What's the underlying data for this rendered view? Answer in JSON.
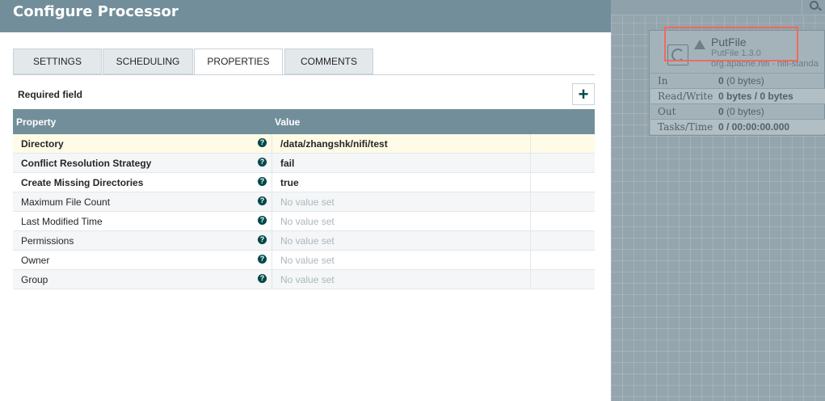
{
  "dialog": {
    "title": "Configure Processor",
    "tabs": [
      {
        "label": "SETTINGS"
      },
      {
        "label": "SCHEDULING"
      },
      {
        "label": "PROPERTIES"
      },
      {
        "label": "COMMENTS"
      }
    ],
    "active_tab": "PROPERTIES",
    "required_label": "Required field",
    "add_button": "+",
    "grid": {
      "headers": {
        "property": "Property",
        "value": "Value"
      },
      "rows": [
        {
          "name": "Directory",
          "value": "/data/zhangshk/nifi/test",
          "required": true
        },
        {
          "name": "Conflict Resolution Strategy",
          "value": "fail",
          "required": true
        },
        {
          "name": "Create Missing Directories",
          "value": "true",
          "required": true
        },
        {
          "name": "Maximum File Count",
          "value": "No value set",
          "required": false
        },
        {
          "name": "Last Modified Time",
          "value": "No value set",
          "required": false
        },
        {
          "name": "Permissions",
          "value": "No value set",
          "required": false
        },
        {
          "name": "Owner",
          "value": "No value set",
          "required": false
        },
        {
          "name": "Group",
          "value": "No value set",
          "required": false
        }
      ],
      "help_glyph": "?"
    }
  },
  "canvas": {
    "processor": {
      "name": "PutFile",
      "version": "PutFile 1.3.0",
      "bundle": "org.apache.nifi - nifi-standa",
      "stats": [
        {
          "label": "In",
          "value_bold": "0",
          "value_rest": " (0 bytes)"
        },
        {
          "label": "Read/Write",
          "value_bold": "0 bytes / 0 bytes",
          "value_rest": ""
        },
        {
          "label": "Out",
          "value_bold": "0",
          "value_rest": " (0 bytes)"
        },
        {
          "label": "Tasks/Time",
          "value_bold": "0 / 00:00:00.000",
          "value_rest": ""
        }
      ]
    }
  },
  "colors": {
    "header": "#728e9b",
    "accent": "#004849",
    "highlight": "#ef6a5e",
    "canvas": "#94a5ad"
  }
}
